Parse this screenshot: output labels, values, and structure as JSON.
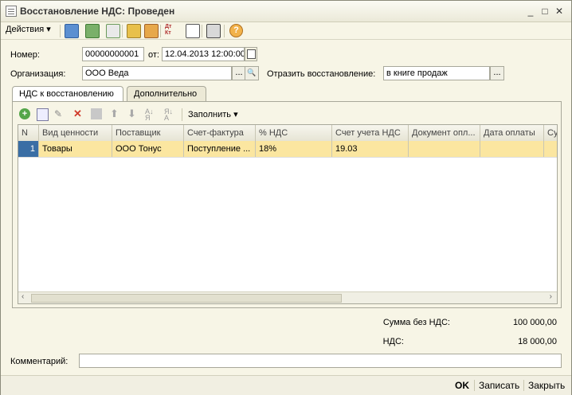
{
  "window": {
    "title": "Восстановление НДС: Проведен",
    "controls": {
      "minimize": "_",
      "maximize": "□",
      "close": "✕"
    }
  },
  "toolbar": {
    "actions_label": "Действия",
    "actions_arrow": "▾",
    "icons": [
      "go-to-icon",
      "refresh-icon",
      "copy-icon",
      "post-icon",
      "unpost-icon",
      "dt-kt-icon",
      "report-icon",
      "list-icon",
      "help-icon"
    ],
    "help_glyph": "?",
    "dtkt_text": "Дт Кт"
  },
  "header": {
    "number_label": "Номер:",
    "number_value": "00000000001",
    "date_label": "от:",
    "date_value": "12.04.2013 12:00:00",
    "org_label": "Организация:",
    "org_value": "ООО Веда",
    "reflect_label": "Отразить восстановление:",
    "reflect_value": "в книге продаж",
    "ellipsis": "...",
    "search_glyph": "🔍"
  },
  "tabs": [
    {
      "label": "НДС к восстановлению",
      "active": true
    },
    {
      "label": "Дополнительно",
      "active": false
    }
  ],
  "grid_toolbar": {
    "fill_label": "Заполнить",
    "fill_arrow": "▾"
  },
  "table": {
    "columns": [
      "N",
      "Вид ценности",
      "Поставщик",
      "Счет-фактура",
      "% НДС",
      "Счет учета НДС",
      "Документ опл...",
      "Дата оплаты",
      "Су"
    ],
    "rows": [
      [
        "1",
        "Товары",
        "ООО Тонус",
        "Поступление ...",
        "18%",
        "19.03",
        "",
        "",
        ""
      ]
    ]
  },
  "summary": {
    "without_vat_label": "Сумма без НДС:",
    "without_vat_value": "100 000,00",
    "vat_label": "НДС:",
    "vat_value": "18 000,00"
  },
  "comment": {
    "label": "Комментарий:",
    "value": ""
  },
  "footer": {
    "ok_label": "OK",
    "save_label": "Записать",
    "close_label": "Закрыть"
  },
  "colors": {
    "selected_row": "#fbe6a0",
    "row_number_bg": "#3a6ea5"
  }
}
